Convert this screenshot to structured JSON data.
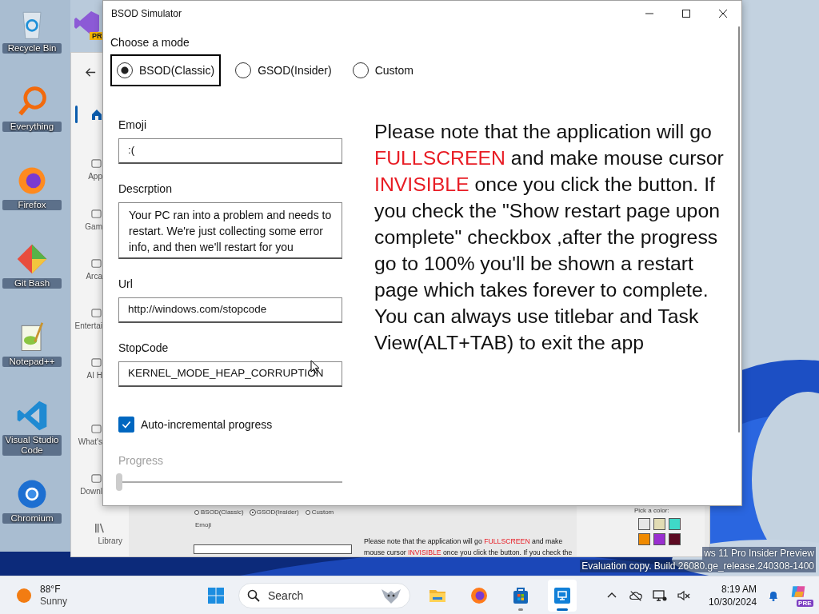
{
  "desktop_icons": [
    {
      "kind": "recycle",
      "label": "Recycle Bin"
    },
    {
      "kind": "everything",
      "label": "Everything"
    },
    {
      "kind": "firefox",
      "label": "Firefox"
    },
    {
      "kind": "gitbash",
      "label": "Git Bash"
    },
    {
      "kind": "notepad",
      "label": "Notepad++"
    },
    {
      "kind": "vscode",
      "label": "Visual Studio Code"
    },
    {
      "kind": "chromium",
      "label": "Chromium"
    }
  ],
  "hidden_shortcut": {
    "badge": "PR"
  },
  "store_window": {
    "sidebar": [
      {
        "kind": "home",
        "selected": true
      },
      {
        "kind": "apps",
        "label": "App",
        "selected": false
      },
      {
        "kind": "gaming",
        "label": "Gam",
        "selected": false
      },
      {
        "kind": "arcade",
        "label": "Arca",
        "selected": false
      },
      {
        "kind": "entertainment",
        "label": "Entertai",
        "selected": false
      },
      {
        "kind": "ai",
        "label": "AI H",
        "selected": false
      },
      {
        "kind": "new",
        "label": "What's",
        "selected": false
      },
      {
        "kind": "downloads",
        "label": "Downl",
        "selected": false
      },
      {
        "kind": "library",
        "label": "Library",
        "selected": false
      }
    ],
    "preview": {
      "modes": [
        {
          "label": "BSOD(Classic)",
          "selected": false
        },
        {
          "label": "GSOD(Insider)",
          "selected": true
        },
        {
          "label": "Custom",
          "selected": false
        }
      ],
      "emoji_label": "Emoji",
      "notice_lines": [
        [
          {
            "text": "Please note that the application will go ",
            "highlight": false
          },
          {
            "text": "FULLSCREEN",
            "highlight": true
          },
          {
            "text": " and make",
            "highlight": false
          }
        ],
        [
          {
            "text": "mouse cursor ",
            "highlight": false
          },
          {
            "text": "INVISIBLE",
            "highlight": true
          },
          {
            "text": " once you click the button. If you check the",
            "highlight": false
          }
        ]
      ],
      "color_label": "Pick a color:",
      "swatches": [
        {
          "color": "#e6e6e6"
        },
        {
          "color": "#e2dcb4"
        },
        {
          "color": "#3fd8c8"
        },
        {
          "color": "#f08a00"
        },
        {
          "color": "#9a2fd0"
        },
        {
          "color": "#5c0a22"
        }
      ]
    }
  },
  "app_window": {
    "title": "BSOD Simulator",
    "mode_label": "Choose a mode",
    "modes": [
      {
        "label": "BSOD(Classic)",
        "selected": true
      },
      {
        "label": "GSOD(Insider)",
        "selected": false
      },
      {
        "label": "Custom",
        "selected": false
      }
    ],
    "fields": [
      {
        "kind": "line",
        "label": "Emoji",
        "value": ":("
      },
      {
        "kind": "multiline",
        "label": "Descrption",
        "value": "Your PC ran into a problem and needs to restart. We're just collecting some error info, and then we'll restart for you"
      },
      {
        "kind": "line",
        "label": "Url",
        "value": "http://windows.com/stopcode"
      },
      {
        "kind": "line",
        "label": "StopCode",
        "value": "KERNEL_MODE_HEAP_CORRUPTION"
      }
    ],
    "auto_progress": {
      "label": "Auto-incremental progress",
      "checked": true
    },
    "progress": {
      "label": "Progress",
      "disabled": true,
      "level": 0
    },
    "notice": [
      {
        "text": "Please note that the application will go ",
        "highlight": false
      },
      {
        "text": "FULLSCREEN",
        "highlight": true
      },
      {
        "text": " and make mouse cursor ",
        "highlight": false
      },
      {
        "text": "INVISIBLE",
        "highlight": true
      },
      {
        "text": " once you click the button. If you check the \"Show restart page upon complete\" checkbox ,after the progress go to 100% you'll be shown a restart page which takes forever to complete. You can always use titlebar and Task View(ALT+TAB) to exit the app",
        "highlight": false
      }
    ]
  },
  "watermark": [
    "ws 11 Pro Insider Preview",
    "Evaluation copy. Build 26080.ge_release.240308-1400"
  ],
  "taskbar": {
    "weather": {
      "temperature": "88°F",
      "condition": "Sunny"
    },
    "search": {
      "placeholder": "Search"
    },
    "apps": [
      {
        "kind": "folder",
        "running": false,
        "selected": false
      },
      {
        "kind": "firefox",
        "running": false,
        "selected": false
      },
      {
        "kind": "store",
        "running": true,
        "selected": false
      },
      {
        "kind": "remote",
        "running": true,
        "selected": true
      }
    ],
    "clock": {
      "time": "8:19 AM",
      "date": "10/30/2024"
    },
    "copilot_badge": "PRE"
  }
}
